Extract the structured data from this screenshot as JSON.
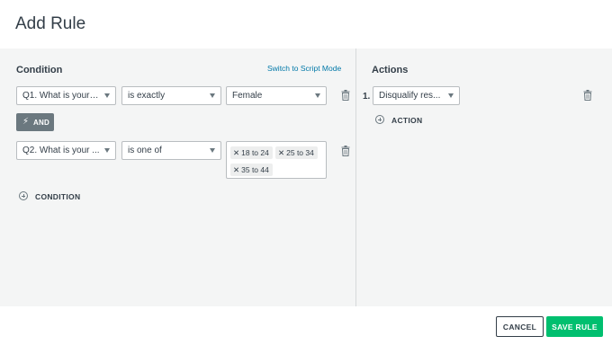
{
  "modal": {
    "title": "Add Rule"
  },
  "condition": {
    "heading": "Condition",
    "script_mode_link": "Switch to Script Mode",
    "rows": [
      {
        "question": "Q1. What is your g...",
        "operator": "is exactly",
        "value": "Female"
      },
      {
        "question": "Q2. What is your ...",
        "operator": "is one of",
        "tags": [
          "18 to 24",
          "25 to 34",
          "35 to 44"
        ]
      }
    ],
    "connector": "AND",
    "add_condition": "CONDITION"
  },
  "actions": {
    "heading": "Actions",
    "items": [
      {
        "number": "1.",
        "action": "Disqualify res..."
      }
    ],
    "add_action": "ACTION"
  },
  "footer": {
    "cancel": "CANCEL",
    "save": "SAVE RULE"
  },
  "colors": {
    "accent": "#00bf6f",
    "link": "#0078a8",
    "and_button": "#6b787f",
    "pane_bg": "#f4f5f5"
  },
  "icons": {
    "trash": "trash-icon",
    "add": "plus-circle-icon",
    "connector": "lightning-icon",
    "remove": "close-icon"
  }
}
